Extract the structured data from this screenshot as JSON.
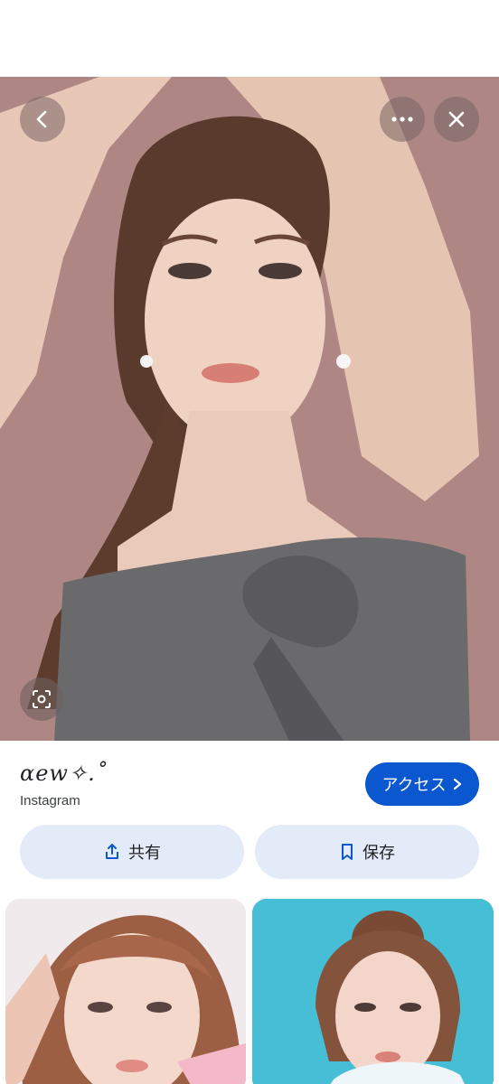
{
  "viewer": {
    "back_icon": "chevron-left-icon",
    "more_icon": "more-horizontal-icon",
    "close_icon": "close-icon",
    "lens_icon": "lens-icon",
    "background_color": "#ae8785"
  },
  "result": {
    "source_title": "ɑew✧.˚",
    "source_name": "Instagram",
    "visit_label": "アクセス",
    "share_label": "共有",
    "save_label": "保存"
  },
  "colors": {
    "accent": "#0b57d0",
    "action_bg": "#e3ebf9"
  }
}
